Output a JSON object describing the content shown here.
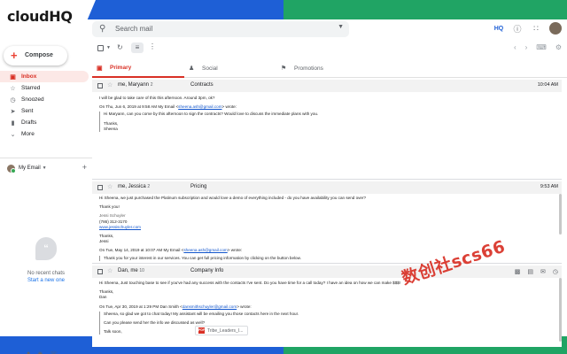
{
  "brand": {
    "logo_text": "cloudHQ",
    "left_color": "#1e5fd6",
    "right_color": "#20a464"
  },
  "search": {
    "placeholder": "Search mail",
    "icon": "search-icon"
  },
  "header_icons": [
    "cloudhq-icon",
    "help-icon",
    "apps-icon",
    "avatar"
  ],
  "header_hq": "HQ",
  "compose": {
    "label": "Compose"
  },
  "nav": [
    {
      "label": "Inbox",
      "icon": "inbox-icon",
      "active": true
    },
    {
      "label": "Starred",
      "icon": "star-icon"
    },
    {
      "label": "Snoozed",
      "icon": "clock-icon"
    },
    {
      "label": "Sent",
      "icon": "send-icon"
    },
    {
      "label": "Drafts",
      "icon": "draft-icon"
    },
    {
      "label": "More",
      "icon": "chevron-down-icon"
    }
  ],
  "my_email": {
    "label": "My Email"
  },
  "hangouts": {
    "empty": "No recent chats",
    "start": "Start a new one"
  },
  "tabs": [
    {
      "label": "Primary",
      "icon": "inbox-icon",
      "active": true
    },
    {
      "label": "Social",
      "icon": "people-icon"
    },
    {
      "label": "Promotions",
      "icon": "tag-icon"
    }
  ],
  "threads": [
    {
      "from": "me, Maryann",
      "count": "2",
      "subject": "Contracts",
      "time": "10:04 AM",
      "body": [
        "I will be glad to take care of this this afternoon. Around 3pm, ok?",
        "On Thu, Jun 6, 2019 at 9:58 AM My Email <",
        "sheena.ash@gmail.com",
        "> wrote:",
        "Hi Maryann, can you come by this afternoon to sign the contracts? Would love to discuss the immediate plans with you.",
        "Thanks,",
        "Sheena"
      ]
    },
    {
      "from": "me, Jessica",
      "count": "2",
      "subject": "Pricing",
      "time": "9:53 AM",
      "body": [
        "Hi Sheena, we just purchased the Platinum subscription and would love a demo of everything included - do you have availability you can send over?",
        "Thank you!",
        "Jessi Schuyler",
        "(786) 312-3170",
        "www.jessischuyler.com",
        "Thanks,",
        "Jessi",
        "On Tue, May 14, 2019 at 10:07 AM My Email <",
        "sheena.ash@gmail.com",
        "> wrote:",
        "Thank you for your interest in our services. You can get full pricing information by clicking on the button below."
      ]
    },
    {
      "from": "Dan, me",
      "count": "10",
      "subject": "Company Info",
      "time": "",
      "body": [
        "Hi Sheena, Just touching base to see if you've had any success with the contacts I've sent. Do you have time for a call today? I have an idea on how we can make $$$!",
        "Thanks,",
        "Dan",
        "On Tue, Apr 30, 2019 at 1:29 PM Dan Smith <",
        "dansmithschuyler@gmail.com",
        "> wrote:",
        "Sheena, so glad we got to chat today! My assistant will be emailing you those contacts here in the next hour.",
        "Can you please send her the info we discussed as well?",
        "Talk soon,"
      ]
    }
  ],
  "attachment": {
    "name": "Tribe_Leaders_I...",
    "type": "PDF"
  },
  "watermark": {
    "text": "数创社scs66"
  }
}
